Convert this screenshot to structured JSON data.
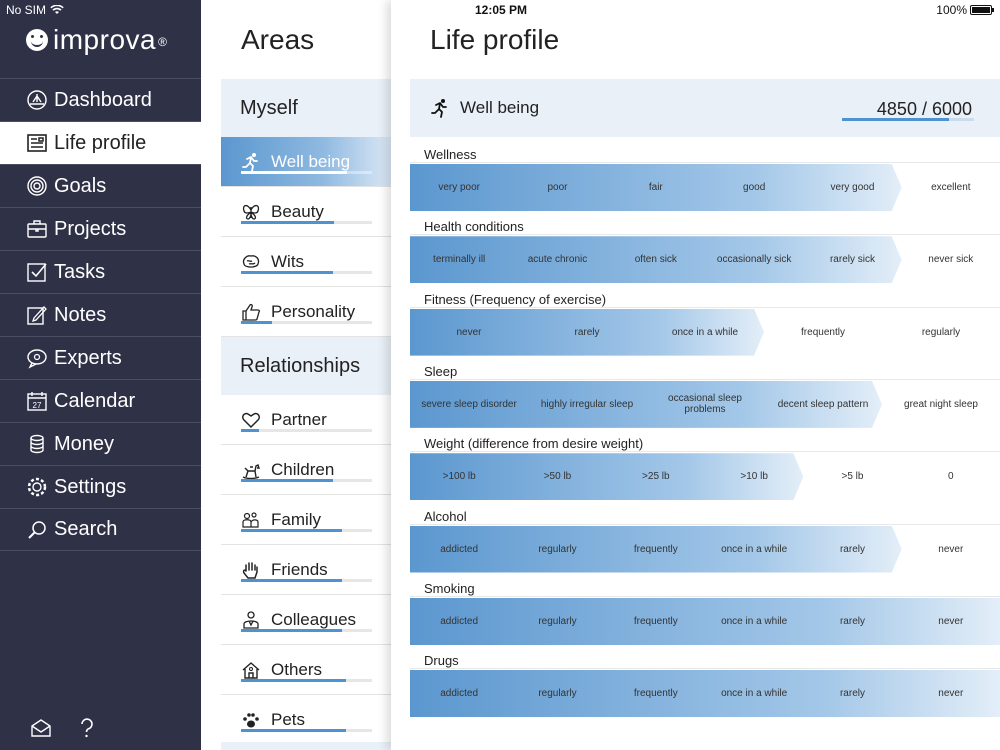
{
  "status": {
    "carrier": "No SIM",
    "time": "12:05 PM",
    "battery": "100%"
  },
  "app": {
    "name": "improva",
    "reg": "®"
  },
  "nav": [
    {
      "label": "Dashboard",
      "icon": "dashboard-icon"
    },
    {
      "label": "Life profile",
      "icon": "life-profile-icon"
    },
    {
      "label": "Goals",
      "icon": "goals-icon"
    },
    {
      "label": "Projects",
      "icon": "projects-icon"
    },
    {
      "label": "Tasks",
      "icon": "tasks-icon"
    },
    {
      "label": "Notes",
      "icon": "notes-icon"
    },
    {
      "label": "Experts",
      "icon": "experts-icon"
    },
    {
      "label": "Calendar",
      "icon": "calendar-icon",
      "day": "27"
    },
    {
      "label": "Money",
      "icon": "money-icon"
    },
    {
      "label": "Settings",
      "icon": "settings-icon"
    },
    {
      "label": "Search",
      "icon": "search-icon"
    }
  ],
  "nav_active": 1,
  "areas": {
    "title": "Areas",
    "groups": [
      {
        "label": "Myself",
        "items": [
          {
            "label": "Well being",
            "icon": "running-icon",
            "progress": 0.81
          },
          {
            "label": "Beauty",
            "icon": "butterfly-icon",
            "progress": 0.71
          },
          {
            "label": "Wits",
            "icon": "brain-icon",
            "progress": 0.7
          },
          {
            "label": "Personality",
            "icon": "thumbs-up-icon",
            "progress": 0.24
          }
        ]
      },
      {
        "label": "Relationships",
        "items": [
          {
            "label": "Partner",
            "icon": "heart-icon",
            "progress": 0.14
          },
          {
            "label": "Children",
            "icon": "rocking-horse-icon",
            "progress": 0.7
          },
          {
            "label": "Family",
            "icon": "family-icon",
            "progress": 0.77
          },
          {
            "label": "Friends",
            "icon": "hand-icon",
            "progress": 0.77
          },
          {
            "label": "Colleagues",
            "icon": "colleague-icon",
            "progress": 0.77
          },
          {
            "label": "Others",
            "icon": "house-icon",
            "progress": 0.8
          },
          {
            "label": "Pets",
            "icon": "paw-icon",
            "progress": 0.8
          }
        ]
      }
    ]
  },
  "profile": {
    "title": "Life profile",
    "section": "Well being",
    "score": "4850 / 6000",
    "score_fraction": 0.81,
    "metrics": [
      {
        "label": "Wellness",
        "options": [
          "very poor",
          "poor",
          "fair",
          "good",
          "very good",
          "excellent"
        ],
        "selected": 4
      },
      {
        "label": "Health conditions",
        "options": [
          "terminally ill",
          "acute chronic",
          "often sick",
          "occasionally sick",
          "rarely sick",
          "never sick"
        ],
        "selected": 4
      },
      {
        "label": "Fitness (Frequency of exercise)",
        "options": [
          "never",
          "rarely",
          "once in a while",
          "frequently",
          "regularly"
        ],
        "selected": 2
      },
      {
        "label": "Sleep",
        "options": [
          "severe sleep disorder",
          "highly irregular sleep",
          "occasional sleep problems",
          "decent sleep pattern",
          "great night sleep"
        ],
        "selected": 3
      },
      {
        "label": "Weight (difference from desire weight)",
        "options": [
          ">100 lb",
          ">50 lb",
          ">25 lb",
          ">10 lb",
          ">5 lb",
          "0"
        ],
        "selected": 3
      },
      {
        "label": "Alcohol",
        "options": [
          "addicted",
          "regularly",
          "frequently",
          "once in a while",
          "rarely",
          "never"
        ],
        "selected": 4
      },
      {
        "label": "Smoking",
        "options": [
          "addicted",
          "regularly",
          "frequently",
          "once in a while",
          "rarely",
          "never"
        ],
        "selected": 5
      },
      {
        "label": "Drugs",
        "options": [
          "addicted",
          "regularly",
          "frequently",
          "once in a while",
          "rarely",
          "never"
        ],
        "selected": 5
      }
    ]
  },
  "colors": {
    "sidebar": "#2f3147",
    "accent": "#4f92d2",
    "highlight": "#e9f0f8"
  },
  "footer_icons": [
    "mail-icon",
    "help-icon"
  ]
}
